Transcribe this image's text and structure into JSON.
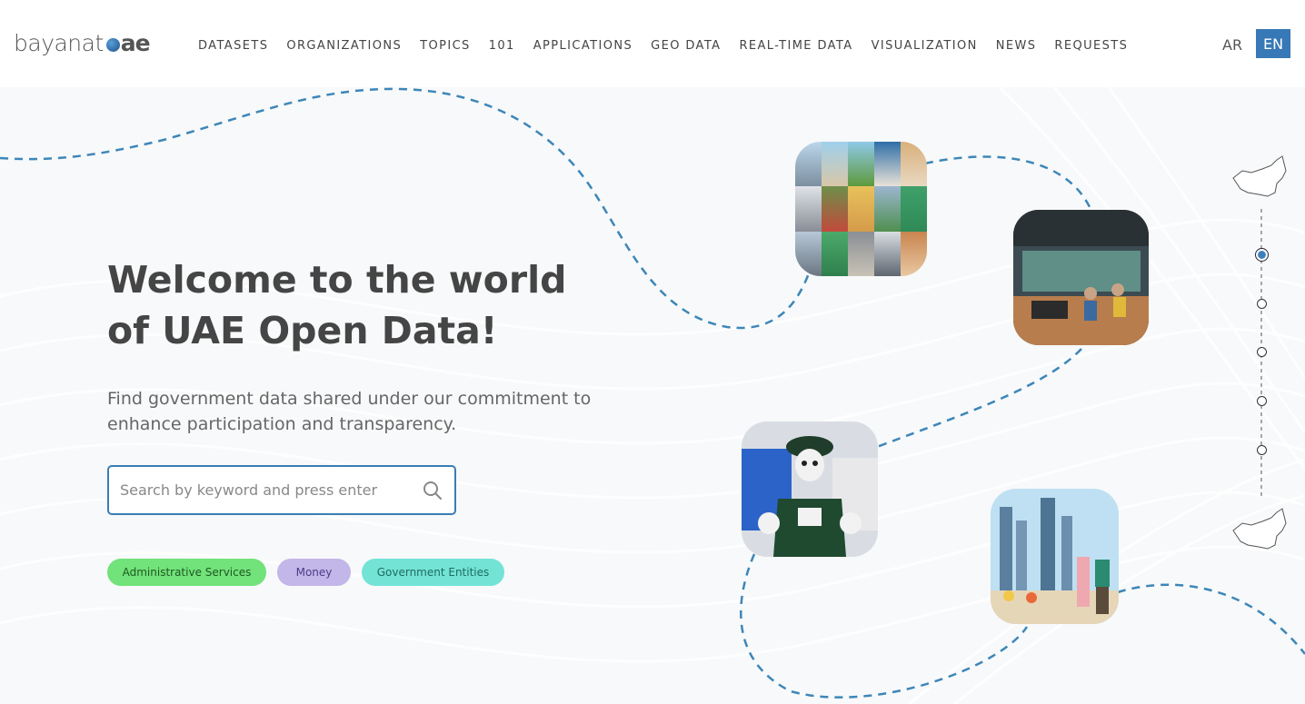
{
  "header": {
    "logo_text": "bayanat",
    "logo_suffix": "ae",
    "nav": [
      "DATASETS",
      "ORGANIZATIONS",
      "TOPICS",
      "101",
      "APPLICATIONS",
      "GEO DATA",
      "REAL-TIME DATA",
      "VISUALIZATION",
      "NEWS",
      "REQUESTS"
    ],
    "lang_ar": "AR",
    "lang_en": "EN"
  },
  "hero": {
    "title_line1": "Welcome to the world",
    "title_line2": "of UAE Open Data!",
    "subtitle_line1": "Find government data shared under our commitment to",
    "subtitle_line2": "enhance participation and transparency.",
    "search_placeholder": "Search by keyword and press enter",
    "search_value": ""
  },
  "tags": [
    {
      "label": "Administrative Services",
      "color": "#72e27a"
    },
    {
      "label": "Money",
      "color": "#c3b6e8"
    },
    {
      "label": "Government Entities",
      "color": "#73e3d6"
    }
  ],
  "colors": {
    "accent": "#3779b6",
    "dashed_path": "#3d86b8"
  },
  "icons": {
    "search": "search-icon",
    "map": "uae-map-icon"
  }
}
